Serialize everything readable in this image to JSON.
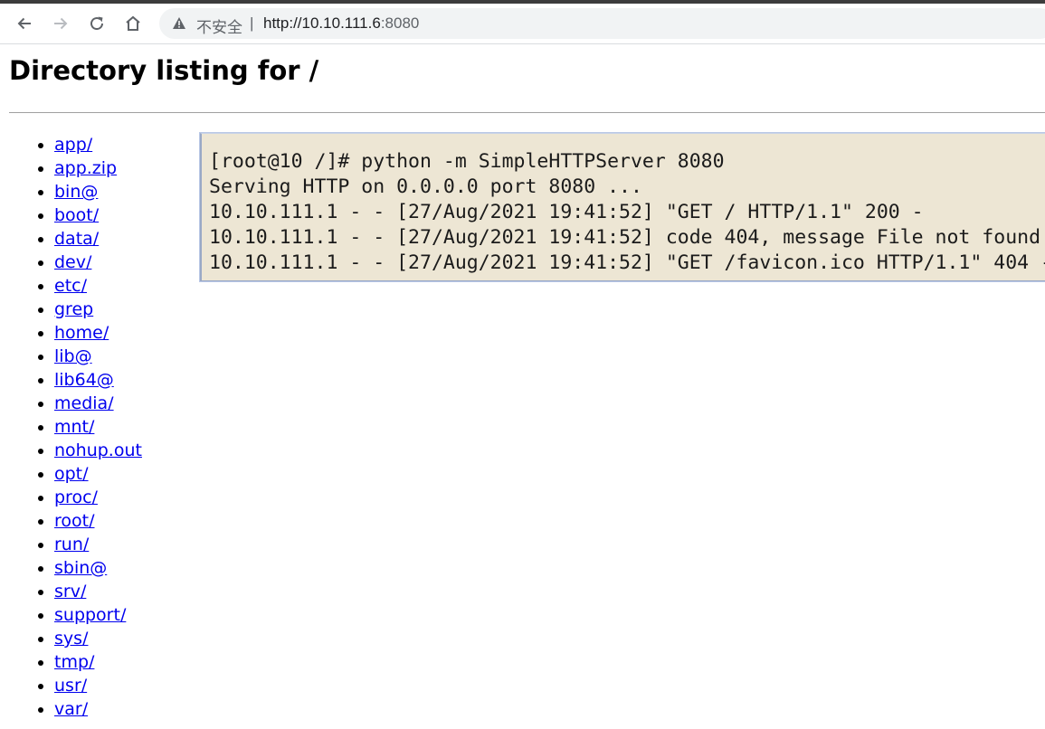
{
  "browser": {
    "security_label": "不安全",
    "separator": "|",
    "url_host": "http://10.10.111.6",
    "url_port": ":8080",
    "icons": [
      "back-arrow-icon",
      "forward-arrow-icon",
      "reload-icon",
      "home-icon",
      "warning-triangle-icon"
    ]
  },
  "page": {
    "heading": "Directory listing for /",
    "entries": [
      "app/",
      "app.zip",
      "bin@",
      "boot/",
      "data/",
      "dev/",
      "etc/",
      "grep",
      "home/",
      "lib@",
      "lib64@",
      "media/",
      "mnt/",
      "nohup.out",
      "opt/",
      "proc/",
      "root/",
      "run/",
      "sbin@",
      "srv/",
      "support/",
      "sys/",
      "tmp/",
      "usr/",
      "var/"
    ]
  },
  "terminal": {
    "lines": [
      "[root@10 /]# python -m SimpleHTTPServer 8080",
      "Serving HTTP on 0.0.0.0 port 8080 ...",
      "10.10.111.1 - - [27/Aug/2021 19:41:52] \"GET / HTTP/1.1\" 200 -",
      "10.10.111.1 - - [27/Aug/2021 19:41:52] code 404, message File not found",
      "10.10.111.1 - - [27/Aug/2021 19:41:52] \"GET /favicon.ico HTTP/1.1\" 404 -"
    ]
  },
  "colors": {
    "link": "#0000ee",
    "terminal_bg": "#ede6d4",
    "omnibox_bg": "#f1f3f4"
  }
}
